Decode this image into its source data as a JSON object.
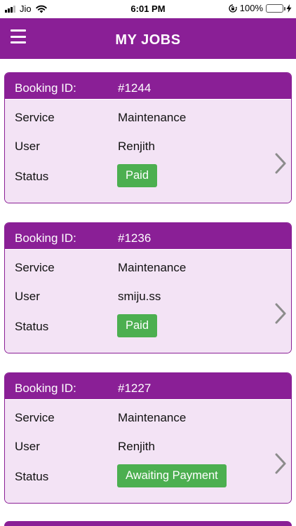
{
  "status_bar": {
    "carrier": "Jio",
    "time": "6:01 PM",
    "battery_percent": "100%",
    "battery_level": 1.0,
    "icons": [
      "signal-icon",
      "wifi-icon",
      "rotation-lock-icon",
      "battery-icon",
      "charging-bolt-icon"
    ]
  },
  "header": {
    "title": "MY JOBS",
    "menu_icon": "hamburger-menu-icon",
    "background_color": "#8a1f96"
  },
  "jobs": [
    {
      "booking_label": "Booking ID:",
      "booking_id": "#1244",
      "service_label": "Service",
      "service": "Maintenance",
      "user_label": "User",
      "user": "Renjith",
      "status_label": "Status",
      "status": "Paid"
    },
    {
      "booking_label": "Booking ID:",
      "booking_id": "#1236",
      "service_label": "Service",
      "service": "Maintenance",
      "user_label": "User",
      "user": "smiju.ss",
      "status_label": "Status",
      "status": "Paid"
    },
    {
      "booking_label": "Booking ID:",
      "booking_id": "#1227",
      "service_label": "Service",
      "service": "Maintenance",
      "user_label": "User",
      "user": "Renjith",
      "status_label": "Status",
      "status": "Awaiting Payment"
    }
  ],
  "colors": {
    "brand": "#8a1f96",
    "card_body": "#f3e3f5",
    "status_badge": "#4caf50",
    "chevron": "#8c8c8c"
  }
}
